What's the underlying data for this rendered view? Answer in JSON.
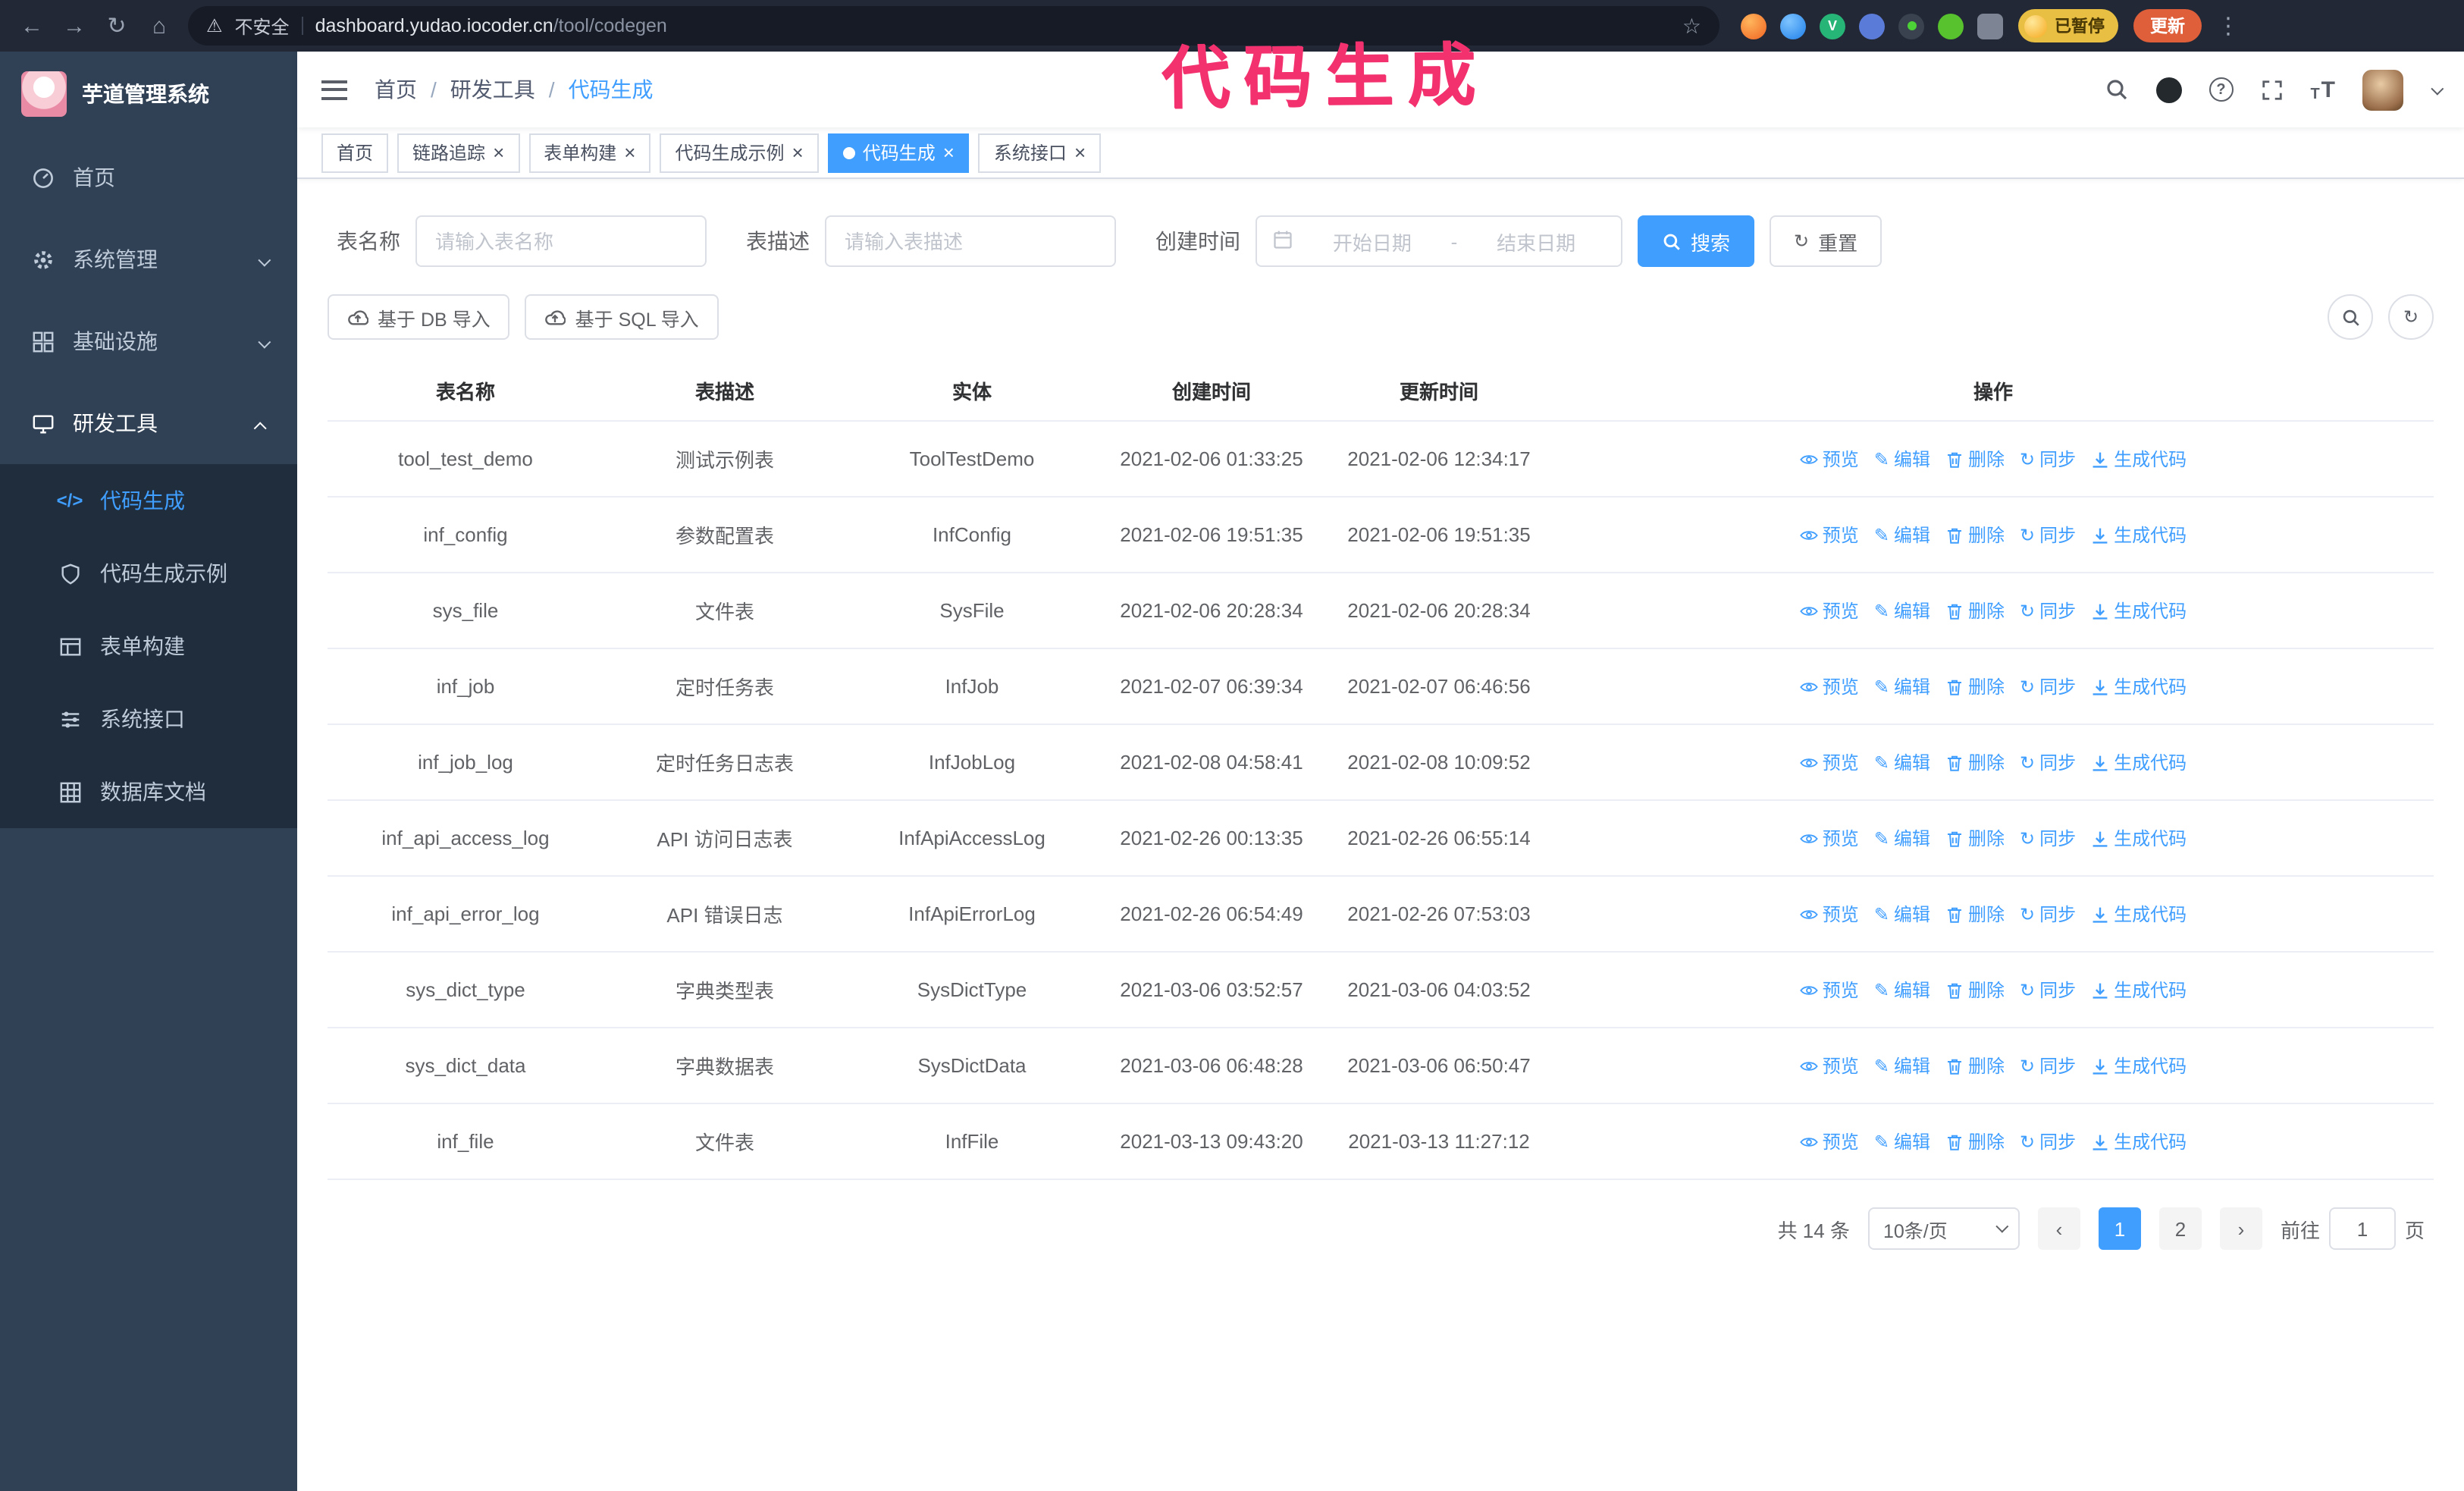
{
  "annotation": {
    "text": "代码生成",
    "color": "#f2316e"
  },
  "browser": {
    "security_label": "不安全",
    "url_host": "dashboard.yudao.iocoder.cn",
    "url_path": "/tool/codegen",
    "profile_badge": "已暂停",
    "update_label": "更新"
  },
  "sidebar": {
    "app_title": "芋道管理系统",
    "items": [
      {
        "label": "首页"
      },
      {
        "label": "系统管理",
        "expandable": true
      },
      {
        "label": "基础设施",
        "expandable": true
      },
      {
        "label": "研发工具",
        "expandable": true,
        "expanded": true
      }
    ],
    "subitems": [
      {
        "label": "代码生成",
        "active": true
      },
      {
        "label": "代码生成示例"
      },
      {
        "label": "表单构建"
      },
      {
        "label": "系统接口"
      },
      {
        "label": "数据库文档"
      }
    ]
  },
  "breadcrumb": {
    "items": [
      "首页",
      "研发工具",
      "代码生成"
    ]
  },
  "tabs": [
    {
      "label": "首页",
      "closable": false,
      "active": false
    },
    {
      "label": "链路追踪",
      "closable": true,
      "active": false
    },
    {
      "label": "表单构建",
      "closable": true,
      "active": false
    },
    {
      "label": "代码生成示例",
      "closable": true,
      "active": false
    },
    {
      "label": "代码生成",
      "closable": true,
      "active": true
    },
    {
      "label": "系统接口",
      "closable": true,
      "active": false
    }
  ],
  "filters": {
    "table_name_label": "表名称",
    "table_name_placeholder": "请输入表名称",
    "table_desc_label": "表描述",
    "table_desc_placeholder": "请输入表描述",
    "create_time_label": "创建时间",
    "date_start_placeholder": "开始日期",
    "date_separator": "-",
    "date_end_placeholder": "结束日期",
    "search_label": "搜索",
    "reset_label": "重置"
  },
  "toolbar": {
    "import_db_label": "基于 DB 导入",
    "import_sql_label": "基于 SQL 导入"
  },
  "table": {
    "columns": [
      "表名称",
      "表描述",
      "实体",
      "创建时间",
      "更新时间",
      "操作"
    ],
    "actions": [
      "预览",
      "编辑",
      "删除",
      "同步",
      "生成代码"
    ],
    "rows": [
      {
        "name": "tool_test_demo",
        "desc": "测试示例表",
        "entity": "ToolTestDemo",
        "created": "2021-02-06 01:33:25",
        "updated": "2021-02-06 12:34:17"
      },
      {
        "name": "inf_config",
        "desc": "参数配置表",
        "entity": "InfConfig",
        "created": "2021-02-06 19:51:35",
        "updated": "2021-02-06 19:51:35"
      },
      {
        "name": "sys_file",
        "desc": "文件表",
        "entity": "SysFile",
        "created": "2021-02-06 20:28:34",
        "updated": "2021-02-06 20:28:34"
      },
      {
        "name": "inf_job",
        "desc": "定时任务表",
        "entity": "InfJob",
        "created": "2021-02-07 06:39:34",
        "updated": "2021-02-07 06:46:56"
      },
      {
        "name": "inf_job_log",
        "desc": "定时任务日志表",
        "entity": "InfJobLog",
        "created": "2021-02-08 04:58:41",
        "updated": "2021-02-08 10:09:52"
      },
      {
        "name": "inf_api_access_log",
        "desc": "API 访问日志表",
        "entity": "InfApiAccessLog",
        "created": "2021-02-26 00:13:35",
        "updated": "2021-02-26 06:55:14"
      },
      {
        "name": "inf_api_error_log",
        "desc": "API 错误日志",
        "entity": "InfApiErrorLog",
        "created": "2021-02-26 06:54:49",
        "updated": "2021-02-26 07:53:03"
      },
      {
        "name": "sys_dict_type",
        "desc": "字典类型表",
        "entity": "SysDictType",
        "created": "2021-03-06 03:52:57",
        "updated": "2021-03-06 04:03:52"
      },
      {
        "name": "sys_dict_data",
        "desc": "字典数据表",
        "entity": "SysDictData",
        "created": "2021-03-06 06:48:28",
        "updated": "2021-03-06 06:50:47"
      },
      {
        "name": "inf_file",
        "desc": "文件表",
        "entity": "InfFile",
        "created": "2021-03-13 09:43:20",
        "updated": "2021-03-13 11:27:12"
      }
    ]
  },
  "pagination": {
    "total_text": "共 14 条",
    "page_size": "10条/页",
    "pages": [
      "1",
      "2"
    ],
    "active_page": "1",
    "goto_label": "前往",
    "goto_value": "1",
    "goto_suffix": "页"
  },
  "colors": {
    "accent": "#409eff",
    "sidebar_bg": "#304156",
    "submenu_bg": "#1f2d3d",
    "annotation": "#f2316e"
  }
}
